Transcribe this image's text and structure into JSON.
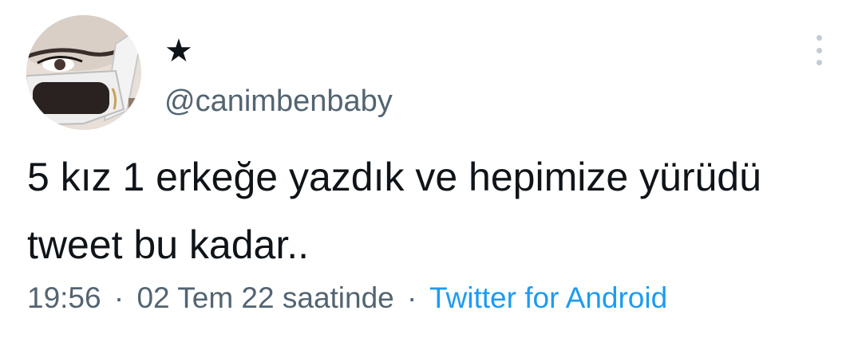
{
  "author": {
    "display_name": "★",
    "handle": "@canimbenbaby"
  },
  "tweet": {
    "text": "5 kız 1 erkeğe yazdık ve hepimize yürüdü tweet bu kadar.."
  },
  "meta": {
    "time": "19:56",
    "date": "02 Tem 22 saatinde",
    "separator": "·",
    "source": "Twitter for Android"
  },
  "icons": {
    "more": "more-vertical-icon"
  },
  "colors": {
    "text": "#0f1419",
    "secondary": "#536471",
    "link": "#1d9bf0",
    "more_icon": "#c4ccd2"
  }
}
